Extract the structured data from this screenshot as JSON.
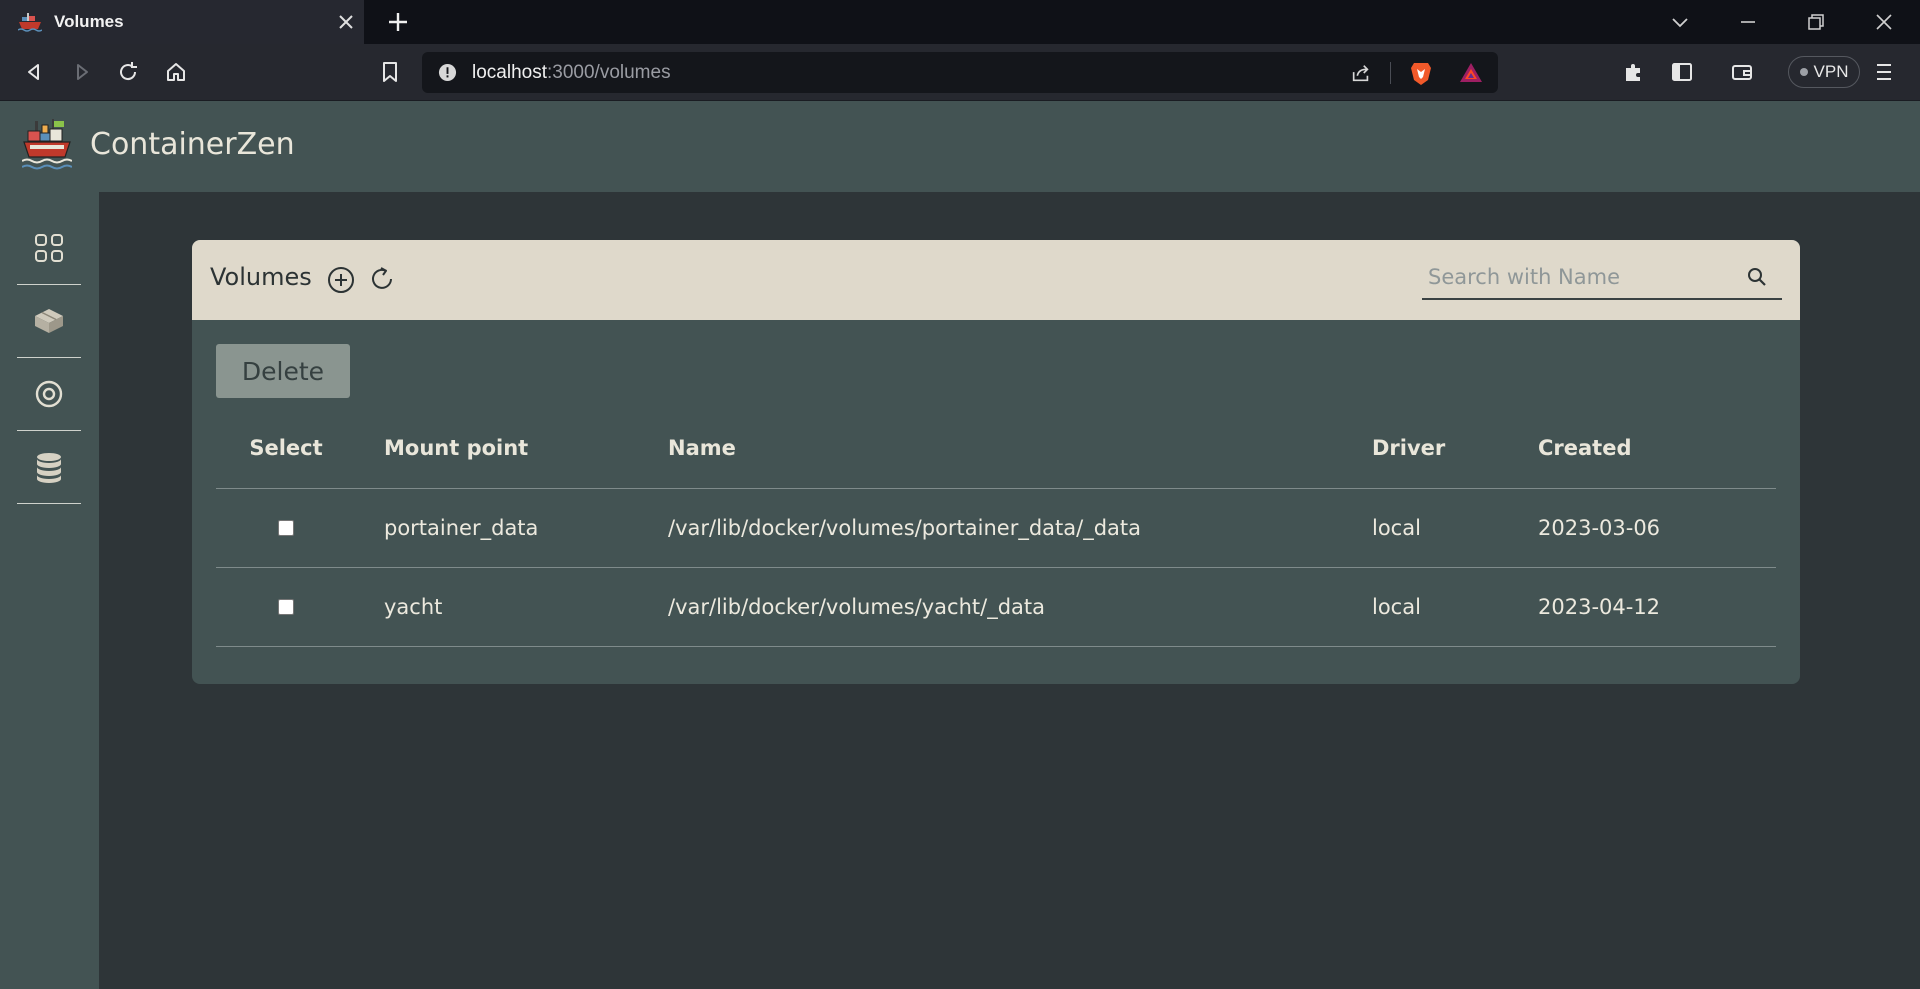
{
  "browser": {
    "tab_title": "Volumes",
    "url_host": "localhost",
    "url_path": ":3000/volumes",
    "vpn_label": "VPN"
  },
  "app": {
    "title": "ContainerZen"
  },
  "sidebar": {
    "items": [
      {
        "icon": "dashboard-grid-icon"
      },
      {
        "icon": "images-box-icon"
      },
      {
        "icon": "networks-target-icon"
      },
      {
        "icon": "volumes-database-icon"
      }
    ]
  },
  "volumes": {
    "title": "Volumes",
    "search_placeholder": "Search with Name",
    "delete_label": "Delete",
    "columns": [
      "Select",
      "Mount point",
      "Name",
      "Driver",
      "Created"
    ],
    "rows": [
      {
        "mount": "portainer_data",
        "name": "/var/lib/docker/volumes/portainer_data/_data",
        "driver": "local",
        "created": "2023-03-06",
        "selected": false
      },
      {
        "mount": "yacht",
        "name": "/var/lib/docker/volumes/yacht/_data",
        "driver": "local",
        "created": "2023-04-12",
        "selected": false
      }
    ]
  },
  "colors": {
    "page_bg": "#2e3538",
    "panel_bg": "#435353",
    "card_header_bg": "#dfd9cb",
    "delete_button_bg": "#8a9590",
    "text_light": "#ece9de"
  }
}
